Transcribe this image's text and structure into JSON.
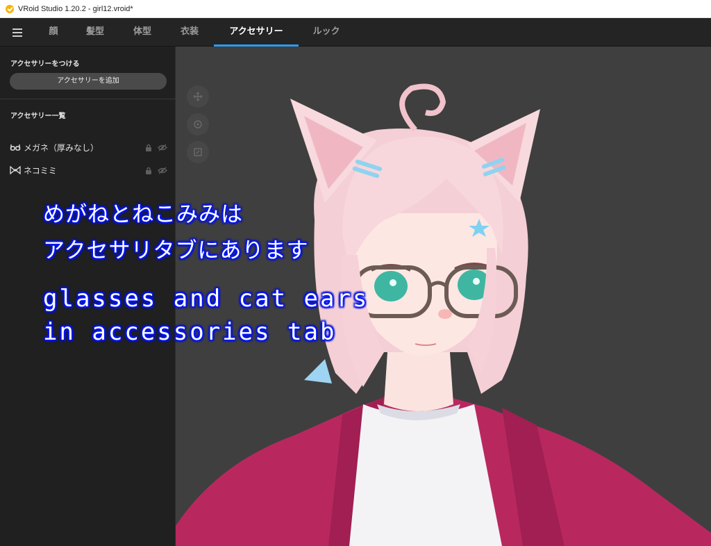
{
  "window": {
    "title": "VRoid Studio 1.20.2 - girl12.vroid*"
  },
  "tabs": [
    {
      "label": "顔",
      "active": false
    },
    {
      "label": "髪型",
      "active": false
    },
    {
      "label": "体型",
      "active": false
    },
    {
      "label": "衣装",
      "active": false
    },
    {
      "label": "アクセサリー",
      "active": true
    },
    {
      "label": "ルック",
      "active": false
    }
  ],
  "sidebar": {
    "add_section_title": "アクセサリーをつける",
    "add_button_label": "アクセサリーを追加",
    "list_section_title": "アクセサリー一覧",
    "items": [
      {
        "label": "メガネ（厚みなし）",
        "icon": "glasses-icon",
        "locked_icon": "lock-icon",
        "visibility_icon": "eye-off-icon"
      },
      {
        "label": "ネコミミ",
        "icon": "bow-icon",
        "locked_icon": "lock-icon",
        "visibility_icon": "eye-off-icon"
      }
    ]
  },
  "viewport": {
    "controls": [
      "move-icon",
      "rotate-icon",
      "zoom-icon"
    ]
  },
  "annotation": {
    "jp_line1": "めがねとねこみみは",
    "jp_line2": "アクセサリタブにあります",
    "en_line1": "glasses and cat ears",
    "en_line2": "in accessories tab"
  },
  "colors": {
    "accent": "#2a9cf2",
    "viewport_bg": "#3f3f3f",
    "panel_bg": "#202020",
    "annotation_glow": "#0a1cff"
  }
}
